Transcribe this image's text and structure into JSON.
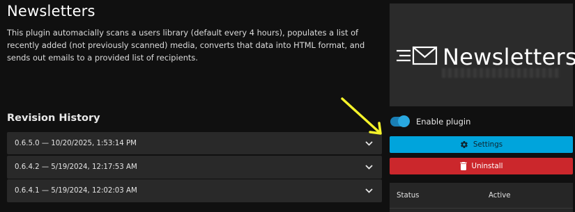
{
  "page": {
    "title": "Newsletters",
    "description": "This plugin automacially scans a users library (default every 4 hours), populates a list of recently added (not previously scanned) media, converts that data into HTML format, and sends out emails to a provided list of recipients."
  },
  "revision_history": {
    "heading": "Revision History",
    "items": [
      {
        "label": "0.6.5.0 — 10/20/2025, 1:53:14 PM"
      },
      {
        "label": "0.6.4.2 — 5/19/2024, 12:17:53 AM"
      },
      {
        "label": "0.6.4.1 — 5/19/2024, 12:02:03 AM"
      }
    ]
  },
  "banner": {
    "text": "Newsletters",
    "icon": "envelope-icon"
  },
  "plugin_toggle": {
    "label": "Enable plugin",
    "enabled": true
  },
  "buttons": {
    "settings": {
      "label": "Settings",
      "icon": "gear-icon"
    },
    "uninstall": {
      "label": "Uninstall",
      "icon": "trash-icon"
    }
  },
  "status": {
    "key": "Status",
    "value": "Active"
  },
  "colors": {
    "accent": "#00a4dc",
    "danger": "#cb272c",
    "annotation_arrow": "#f5f32a"
  }
}
